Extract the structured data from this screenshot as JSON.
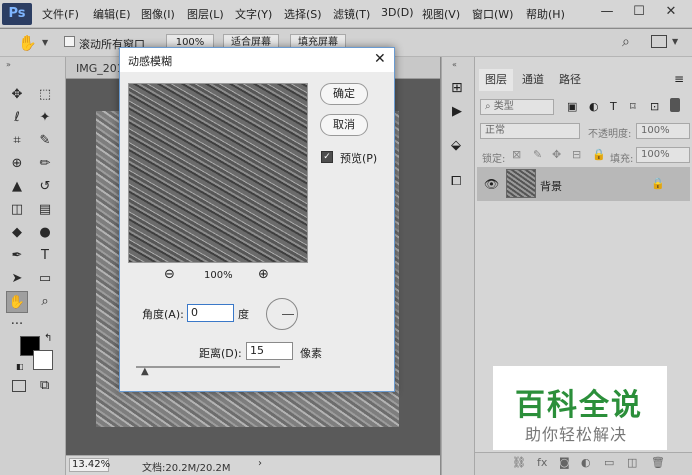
{
  "app_logo": "Ps",
  "menu": [
    "文件(F)",
    "编辑(E)",
    "图像(I)",
    "图层(L)",
    "文字(Y)",
    "选择(S)",
    "滤镜(T)",
    "3D(D)",
    "视图(V)",
    "窗口(W)",
    "帮助(H)"
  ],
  "window_controls": {
    "min": "—",
    "max": "☐",
    "close": "✕"
  },
  "options": {
    "scroll_all_label": "滚动所有窗口",
    "zoom_100": "100%",
    "fit_screen": "适合屏幕",
    "fill_screen": "填充屏幕"
  },
  "document": {
    "tab_title": "IMG_201",
    "zoom": "13.42%",
    "doc_info": "文档:20.2M/20.2M"
  },
  "dialog": {
    "title": "动感模糊",
    "ok": "确定",
    "cancel": "取消",
    "preview_label": "预览(P)",
    "zoom_level": "100%",
    "angle_label": "角度(A):",
    "angle_value": "0",
    "angle_unit": "度",
    "distance_label": "距离(D):",
    "distance_value": "15",
    "distance_unit": "像素"
  },
  "panel": {
    "tabs": [
      "图层",
      "通道",
      "路径"
    ],
    "filter_kind": "类型",
    "blend_mode": "正常",
    "opacity_label": "不透明度:",
    "opacity_value": "100%",
    "lock_label": "锁定:",
    "fill_label": "填充:",
    "fill_value": "100%",
    "layer_name": "背景"
  },
  "watermark": {
    "title": "百科全说",
    "subtitle": "助你轻松解决"
  },
  "colors": {
    "accent": "#2b8f3a",
    "dialog_border": "#6a9bd1"
  }
}
